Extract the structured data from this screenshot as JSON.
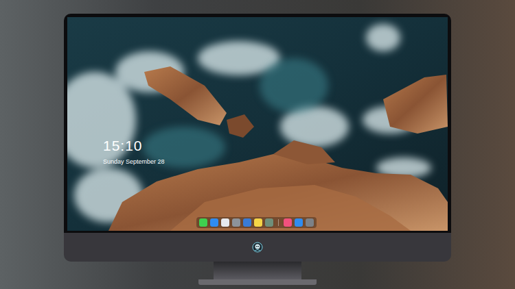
{
  "lock_screen": {
    "time": "15:10",
    "date": "Sunday September 28"
  },
  "dock": {
    "groups": [
      [
        {
          "color": "#3ecf4f"
        },
        {
          "color": "#2f8cf0"
        },
        {
          "color": "#e6e9ee"
        },
        {
          "color": "#8d939a"
        },
        {
          "color": "#3a7bd5"
        },
        {
          "color": "#f5d547"
        },
        {
          "color": "#6f8f7a"
        }
      ],
      [
        {
          "color": "#f2517d"
        },
        {
          "color": "#2f8cf0"
        },
        {
          "color": "#7c8187"
        }
      ]
    ]
  }
}
